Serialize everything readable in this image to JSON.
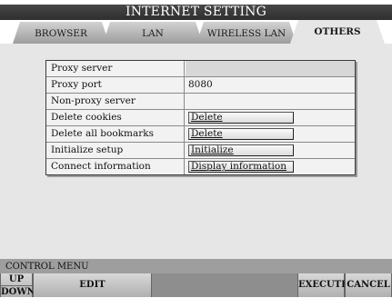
{
  "title": "INTERNET SETTING",
  "tabs": [
    {
      "label": "BROWSER",
      "active": false
    },
    {
      "label": "LAN",
      "active": false
    },
    {
      "label": "WIRELESS LAN",
      "active": false
    },
    {
      "label": "OTHERS",
      "active": true
    }
  ],
  "settings": {
    "proxy_server": {
      "label": "Proxy server",
      "value": ""
    },
    "proxy_port": {
      "label": "Proxy port",
      "value": "8080"
    },
    "non_proxy_server": {
      "label": "Non-proxy server",
      "value": ""
    },
    "delete_cookies": {
      "label": "Delete cookies",
      "button": "Delete"
    },
    "delete_bookmarks": {
      "label": "Delete all bookmarks",
      "button": "Delete"
    },
    "initialize_setup": {
      "label": "Initialize setup",
      "button": "Initialize"
    },
    "connect_information": {
      "label": "Connect information",
      "button": "Display information"
    }
  },
  "control_menu": {
    "label": "CONTROL MENU",
    "up": "UP",
    "down": "DOWN",
    "edit": "EDIT",
    "execute": "EXECUTE",
    "cancel": "CANCEL"
  }
}
